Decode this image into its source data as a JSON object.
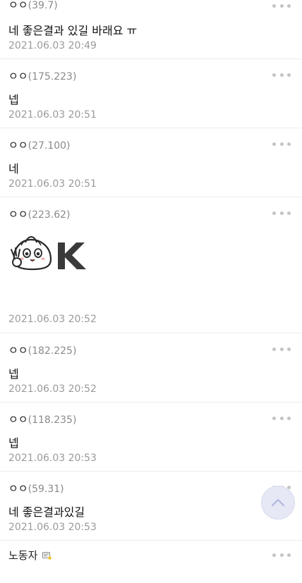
{
  "comments": [
    {
      "author": "ㅇㅇ",
      "ip": "(39.7)",
      "text": "네 좋은결과 있길 바래요 ㅠ",
      "date": "2021.06.03 20:49"
    },
    {
      "author": "ㅇㅇ",
      "ip": "(175.223)",
      "text": "넵",
      "date": "2021.06.03 20:51"
    },
    {
      "author": "ㅇㅇ",
      "ip": "(27.100)",
      "text": "네",
      "date": "2021.06.03 20:51"
    },
    {
      "author": "ㅇㅇ",
      "ip": "(223.62)",
      "text": "",
      "date": "2021.06.03 20:52",
      "sticker": "dumpling-ok-sticker"
    },
    {
      "author": "ㅇㅇ",
      "ip": "(182.225)",
      "text": "넵",
      "date": "2021.06.03 20:52"
    },
    {
      "author": "ㅇㅇ",
      "ip": "(118.235)",
      "text": "넵",
      "date": "2021.06.03 20:53"
    },
    {
      "author": "ㅇㅇ",
      "ip": "(59.31)",
      "text": "네 좋은결과있길",
      "date": "2021.06.03 20:53"
    },
    {
      "author": "노동자",
      "ip": "",
      "text": "",
      "date": "",
      "badge": "fixed-nick-icon"
    }
  ],
  "icons": {
    "more": "more-dots-icon",
    "scroll_top": "chevron-up-icon"
  },
  "colors": {
    "ip": "#8a8a8a",
    "date": "#9a9a9a",
    "divider": "#ececec",
    "scroll_button": "#e6e8f6"
  }
}
